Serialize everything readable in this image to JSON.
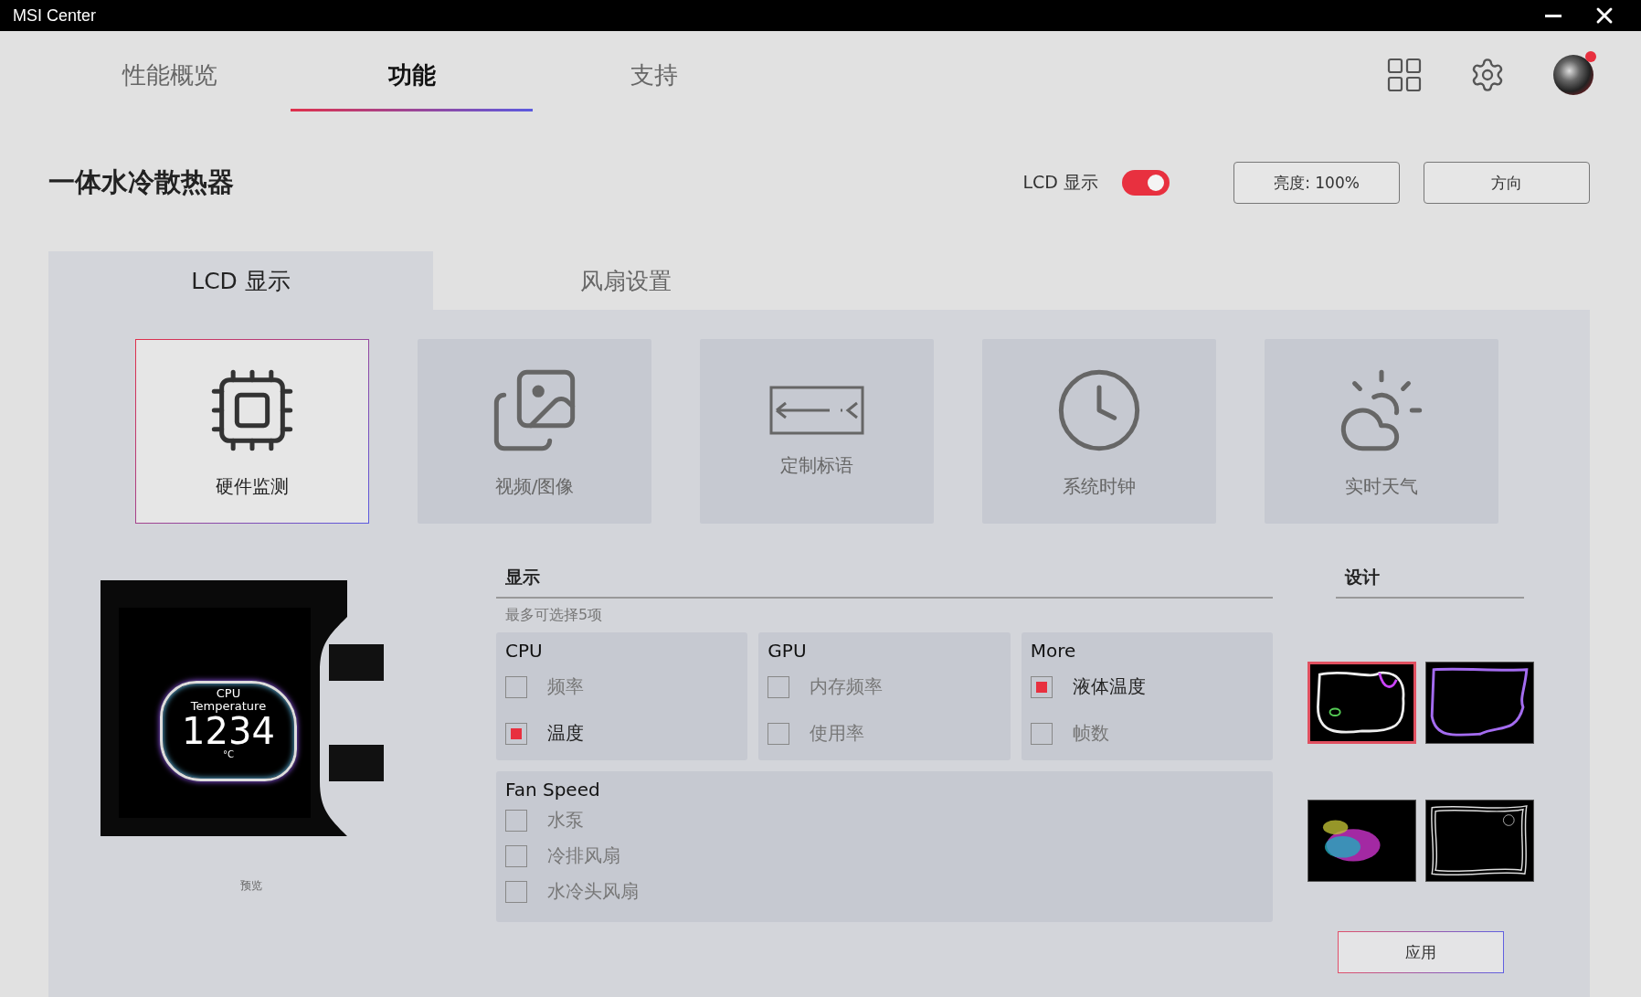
{
  "window": {
    "title": "MSI Center"
  },
  "nav_tabs": [
    {
      "label": "性能概览",
      "selected": false
    },
    {
      "label": "功能",
      "selected": true
    },
    {
      "label": "支持",
      "selected": false
    }
  ],
  "page": {
    "title": "一体水冷散热器",
    "lcd_toggle": {
      "label": "LCD 显示",
      "on": true
    },
    "buttons": [
      "亮度: 100%",
      "方向"
    ]
  },
  "sub_tabs": [
    {
      "label": "LCD 显示",
      "selected": true
    },
    {
      "label": "风扇设置",
      "selected": false
    }
  ],
  "modes": [
    {
      "label": "硬件监测",
      "selected": true
    },
    {
      "label": "视频/图像",
      "selected": false
    },
    {
      "label": "定制标语",
      "selected": false
    },
    {
      "label": "系统时钟",
      "selected": false
    },
    {
      "label": "实时天气",
      "selected": false
    }
  ],
  "preview": {
    "screen": {
      "label": "CPU",
      "sublabel": "Temperature",
      "value": "1234",
      "unit": "°C"
    },
    "caption": "预览"
  },
  "display": {
    "title": "显示",
    "hint": "最多可选择5项",
    "groups": [
      {
        "title": "CPU",
        "items": [
          {
            "label": "频率",
            "checked": false
          },
          {
            "label": "温度",
            "checked": true
          }
        ]
      },
      {
        "title": "GPU",
        "items": [
          {
            "label": "内存频率",
            "checked": false
          },
          {
            "label": "使用率",
            "checked": false
          }
        ]
      },
      {
        "title": "More",
        "items": [
          {
            "label": "液体温度",
            "checked": true
          },
          {
            "label": "帧数",
            "checked": false
          }
        ]
      }
    ],
    "fan_speed": {
      "title": "Fan Speed",
      "items": [
        {
          "label": "水泵",
          "checked": false
        },
        {
          "label": "冷排风扇",
          "checked": false
        },
        {
          "label": "水冷头风扇",
          "checked": false
        }
      ]
    }
  },
  "design": {
    "title": "设计",
    "themes": [
      {
        "selected": true
      },
      {
        "selected": false
      },
      {
        "selected": false
      },
      {
        "selected": false
      }
    ],
    "apply_button": "应用"
  }
}
